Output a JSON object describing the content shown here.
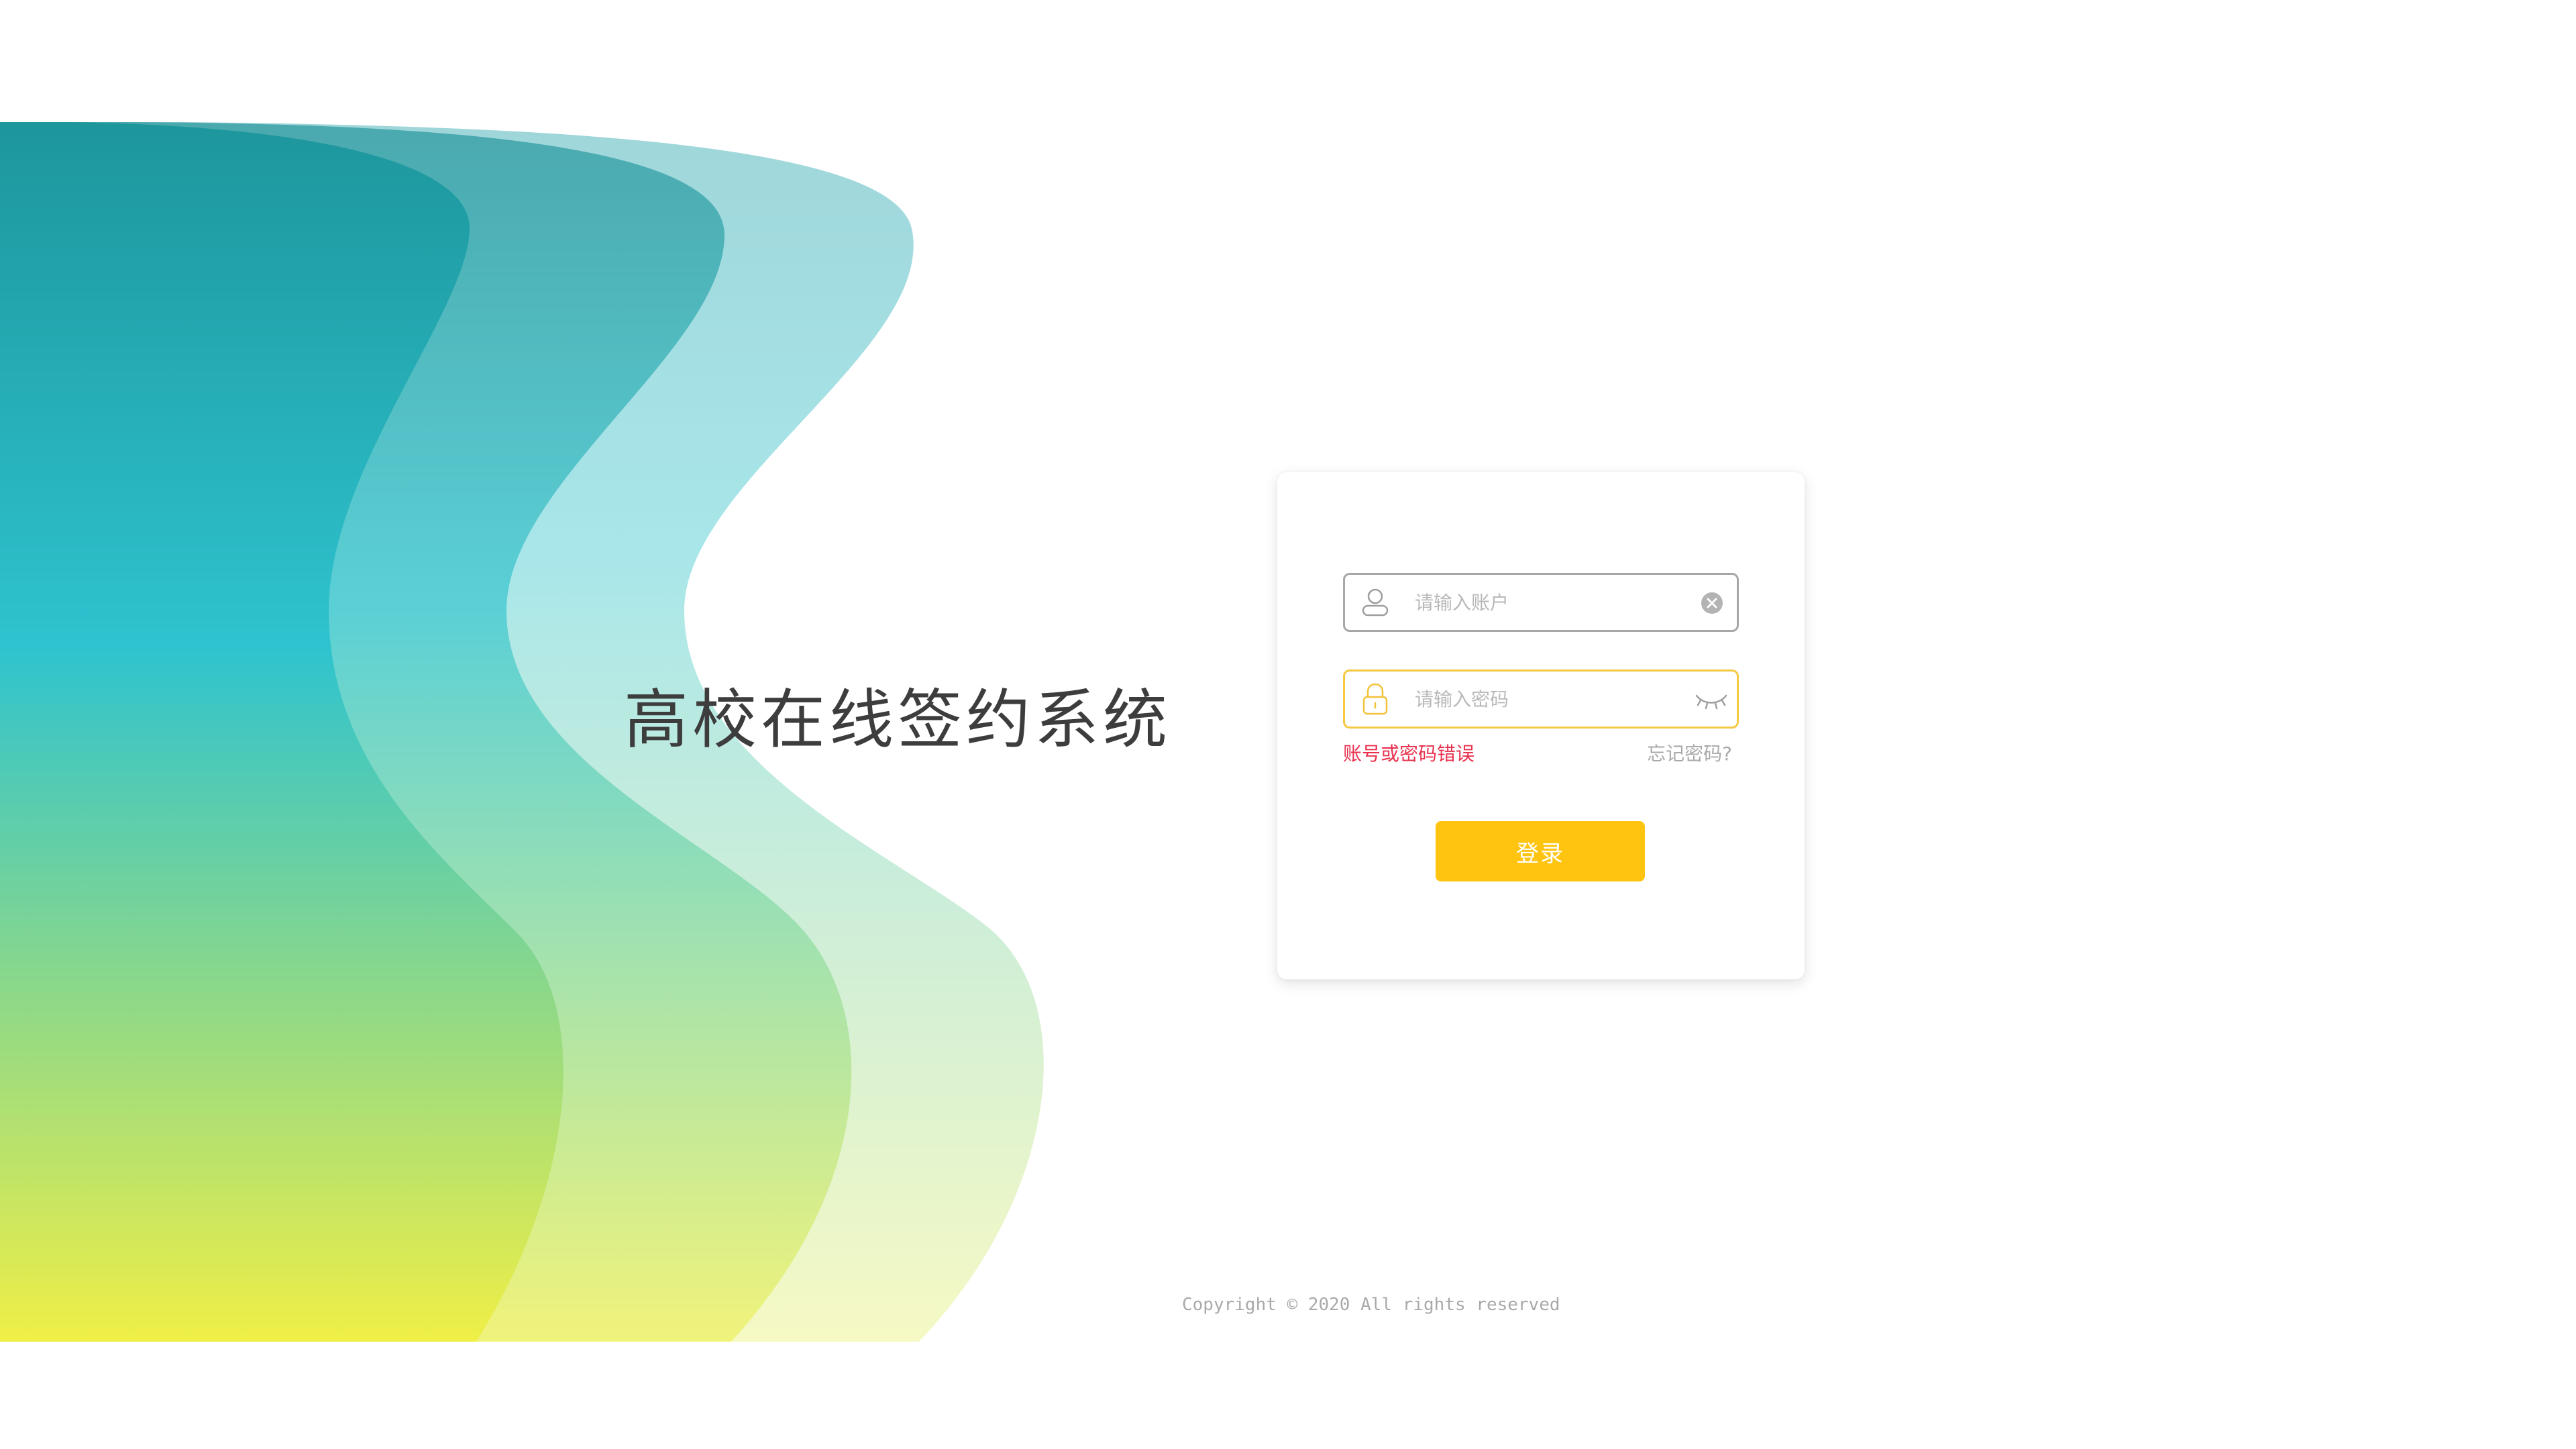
{
  "title": "高校在线签约系统",
  "login": {
    "account": {
      "placeholder": "请输入账户",
      "value": "",
      "icon": "user-icon",
      "clear_icon": "clear-icon"
    },
    "password": {
      "placeholder": "请输入密码",
      "value": "",
      "icon": "lock-icon",
      "toggle_icon": "eye-closed-icon"
    },
    "error": "账号或密码错误",
    "forgot": "忘记密码?",
    "submit": "登录"
  },
  "footer": {
    "copyright": "Copyright © 2020 All rights reserved"
  },
  "colors": {
    "accent": "#ffc410",
    "error": "#e8304e",
    "wave_top": "#1d979d",
    "wave_mid": "#2dc4cf",
    "wave_bottom": "#f0ef48"
  }
}
